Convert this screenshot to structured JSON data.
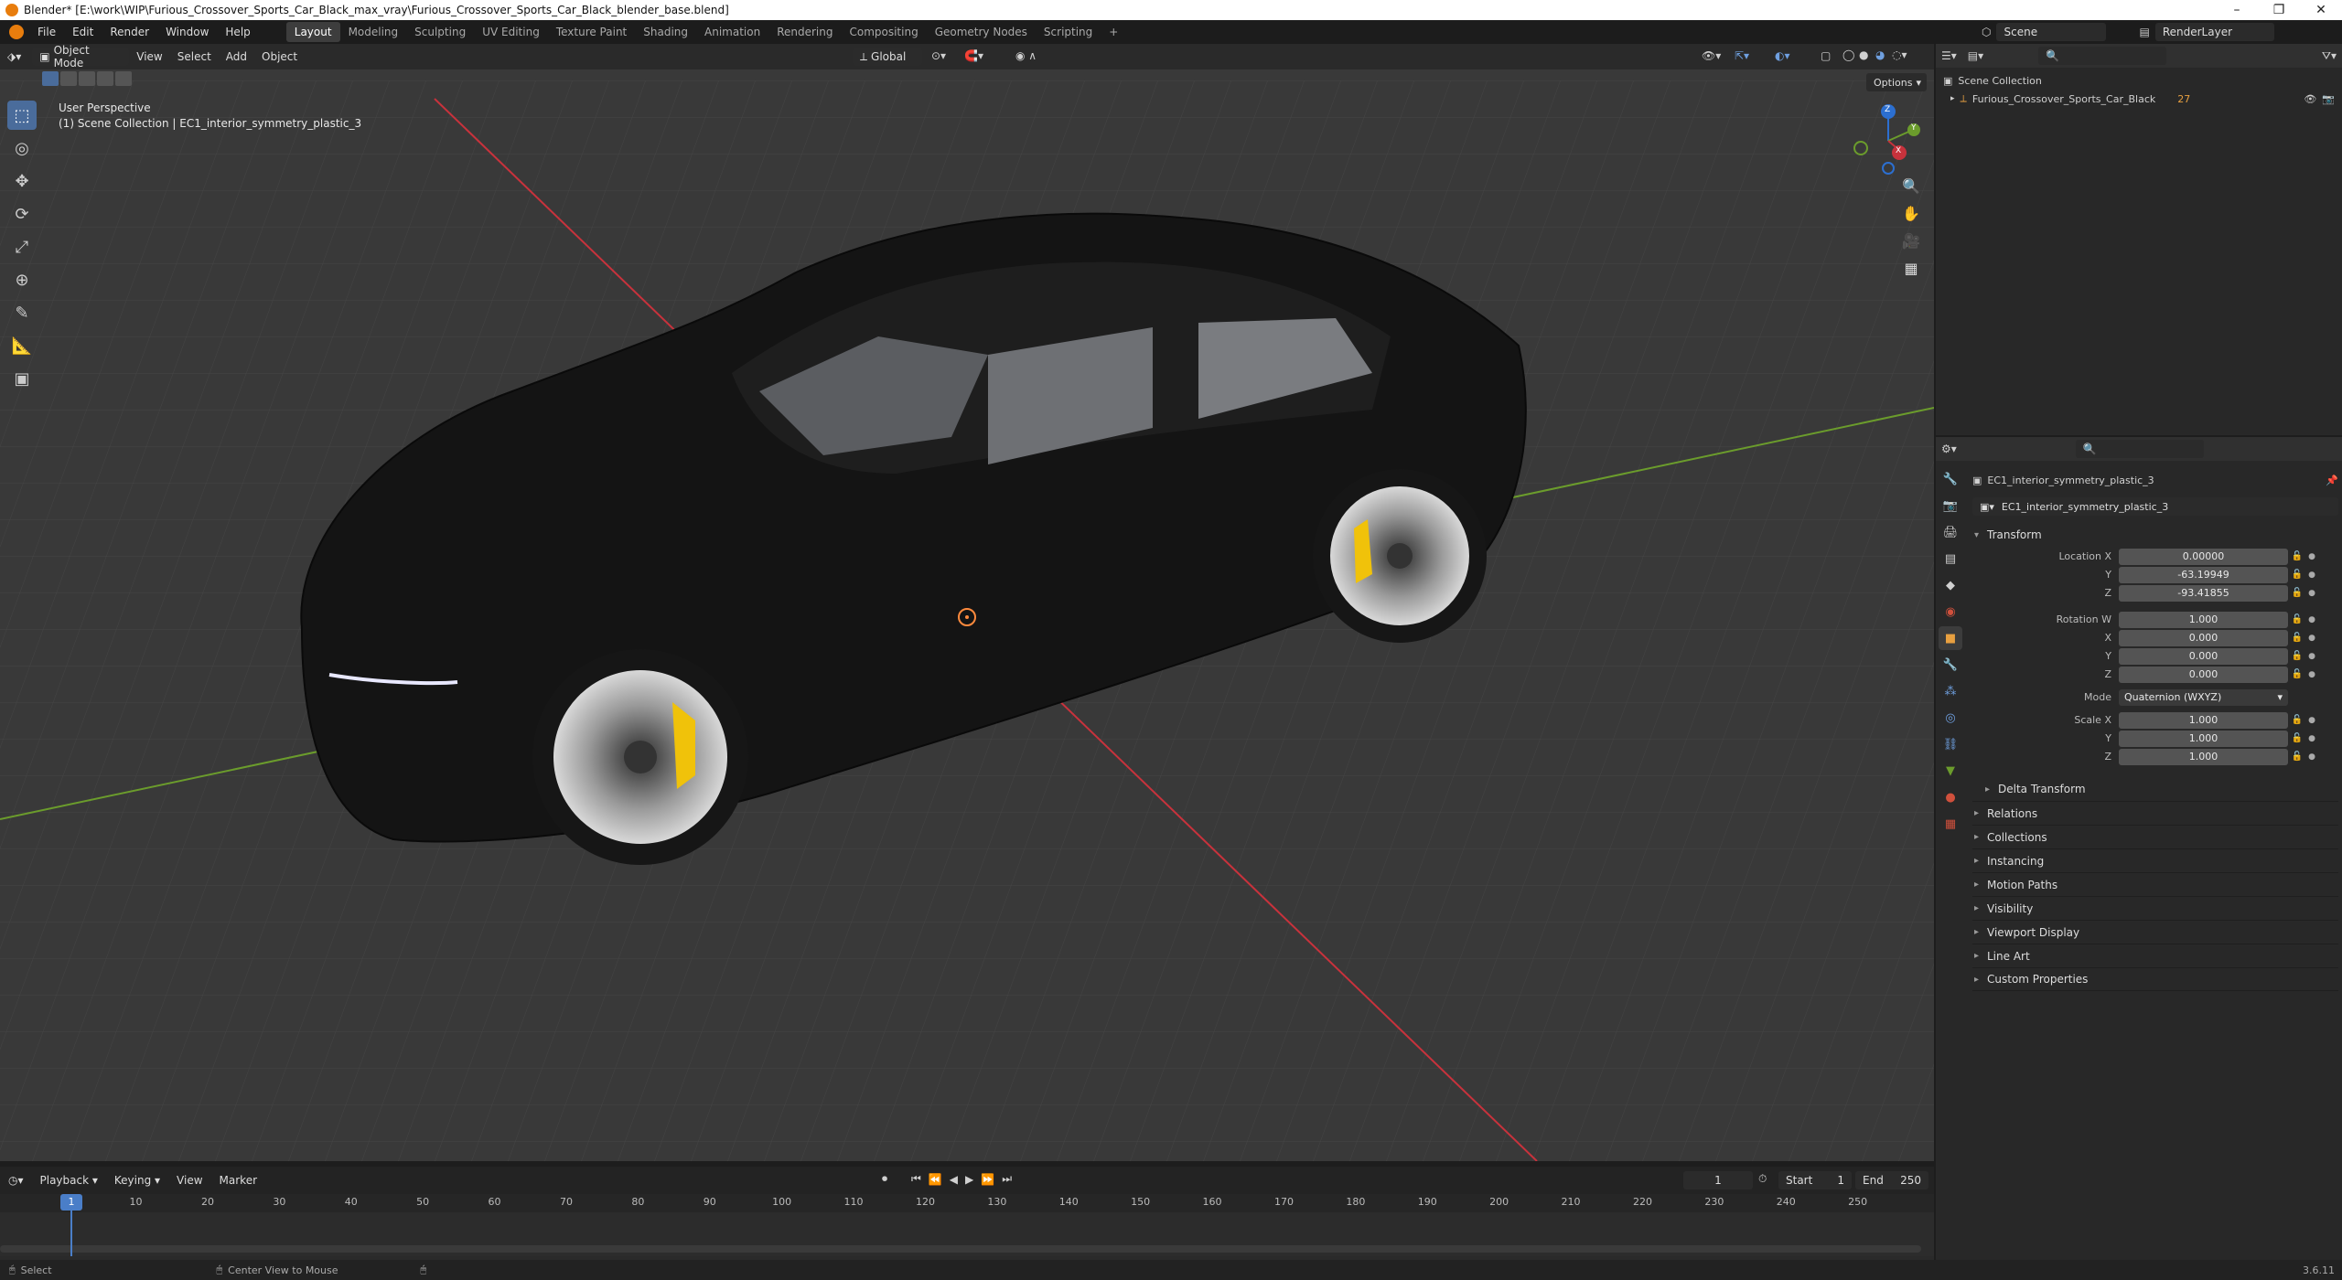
{
  "window": {
    "title": "Blender* [E:\\work\\WIP\\Furious_Crossover_Sports_Car_Black_max_vray\\Furious_Crossover_Sports_Car_Black_blender_base.blend]",
    "minimize": "–",
    "maximize": "❐",
    "close": "✕"
  },
  "menu": [
    "File",
    "Edit",
    "Render",
    "Window",
    "Help"
  ],
  "workspaces": [
    "Layout",
    "Modeling",
    "Sculpting",
    "UV Editing",
    "Texture Paint",
    "Shading",
    "Animation",
    "Rendering",
    "Compositing",
    "Geometry Nodes",
    "Scripting",
    "+"
  ],
  "active_workspace": "Layout",
  "scene": {
    "name": "Scene",
    "render_layer": "RenderLayer"
  },
  "viewport": {
    "mode": "Object Mode",
    "menus": [
      "View",
      "Select",
      "Add",
      "Object"
    ],
    "orientation": "Global",
    "options": "Options",
    "perspective_label": "User Perspective",
    "collection_label": "(1) Scene Collection | EC1_interior_symmetry_plastic_3",
    "gizmo_axes": [
      "Z",
      "Y",
      "X"
    ]
  },
  "outliner": {
    "root": "Scene Collection",
    "items": [
      {
        "name": "Furious_Crossover_Sports_Car_Black",
        "badge": "27"
      }
    ]
  },
  "properties": {
    "search_placeholder": "",
    "object_name": "EC1_interior_symmetry_plastic_3",
    "data_name": "EC1_interior_symmetry_plastic_3",
    "transform_label": "Transform",
    "location": {
      "label_x": "Location X",
      "x": "0.00000",
      "y": "-63.19949",
      "z": "-93.41855"
    },
    "rotation": {
      "label_w": "Rotation W",
      "w": "1.000",
      "x": "0.000",
      "y": "0.000",
      "z": "0.000"
    },
    "mode": {
      "label": "Mode",
      "value": "Quaternion (WXYZ)"
    },
    "scale": {
      "label_x": "Scale X",
      "x": "1.000",
      "y": "1.000",
      "z": "1.000"
    },
    "axis_labels": {
      "x": "X",
      "y": "Y",
      "z": "Z"
    },
    "delta_transform": "Delta Transform",
    "sections": [
      "Relations",
      "Collections",
      "Instancing",
      "Motion Paths",
      "Visibility",
      "Viewport Display",
      "Line Art",
      "Custom Properties"
    ]
  },
  "timeline": {
    "menus": [
      "Playback",
      "Keying",
      "View",
      "Marker"
    ],
    "current_frame": "1",
    "start_label": "Start",
    "start": "1",
    "end_label": "End",
    "end": "250",
    "ruler": [
      "1",
      "10",
      "20",
      "30",
      "40",
      "50",
      "60",
      "70",
      "80",
      "90",
      "100",
      "110",
      "120",
      "130",
      "140",
      "150",
      "160",
      "170",
      "180",
      "190",
      "200",
      "210",
      "220",
      "230",
      "240",
      "250"
    ]
  },
  "status": {
    "select": "Select",
    "center_view": "Center View to Mouse",
    "version": "3.6.11"
  },
  "colors": {
    "accent": "#4a6c9b",
    "x_axis": "#c8323c",
    "y_axis": "#6b9c2c",
    "z_axis": "#2c6fd0",
    "caliper": "#f0c20a"
  }
}
